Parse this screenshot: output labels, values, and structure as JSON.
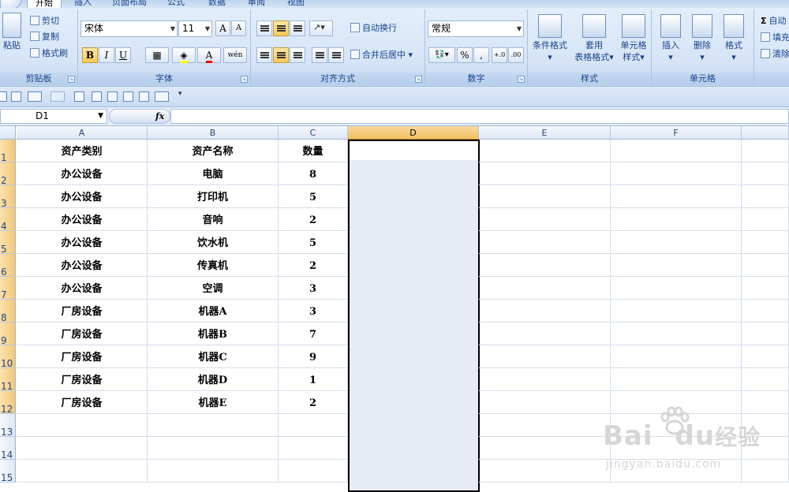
{
  "ribbon": {
    "tabs": [
      "开始",
      "插入",
      "页面布局",
      "公式",
      "数据",
      "审阅",
      "视图"
    ],
    "clipboard": {
      "paste": "粘贴",
      "cut": "剪切",
      "copy": "复制",
      "format_painter": "格式刷",
      "label": "剪贴板"
    },
    "font": {
      "name": "宋体",
      "size": "11",
      "bold": "B",
      "italic": "I",
      "underline": "U",
      "grow": "A",
      "shrink": "A",
      "font_color": "A",
      "label": "字体",
      "wen": "wén"
    },
    "alignment": {
      "wrap_text": "自动换行",
      "merge_center": "合并后居中",
      "label": "对齐方式"
    },
    "number": {
      "format": "常规",
      "percent": "%",
      "comma": ",",
      "inc_dec": "+.0",
      "dec_dec": ".00",
      "label": "数字"
    },
    "styles": {
      "conditional": "条件格式",
      "table_1": "套用",
      "table_2": "表格格式",
      "cell_style_1": "单元格",
      "cell_style_2": "样式",
      "label": "样式"
    },
    "cells": {
      "insert": "插入",
      "delete": "删除",
      "format": "格式",
      "label": "单元格"
    },
    "editing": {
      "autosum": "自动",
      "fill": "填充",
      "clear": "清除",
      "sigma": "Σ"
    }
  },
  "formula_bar": {
    "name_box": "D1",
    "fx": "fx",
    "formula": ""
  },
  "columns": [
    "A",
    "B",
    "C",
    "D",
    "E",
    "F"
  ],
  "rows": [
    {
      "num": "1",
      "a": "资产类别",
      "b": "资产名称",
      "c": "数量"
    },
    {
      "num": "2",
      "a": "办公设备",
      "b": "电脑",
      "c": "8"
    },
    {
      "num": "3",
      "a": "办公设备",
      "b": "打印机",
      "c": "5"
    },
    {
      "num": "4",
      "a": "办公设备",
      "b": "音响",
      "c": "2"
    },
    {
      "num": "5",
      "a": "办公设备",
      "b": "饮水机",
      "c": "5"
    },
    {
      "num": "6",
      "a": "办公设备",
      "b": "传真机",
      "c": "2"
    },
    {
      "num": "7",
      "a": "办公设备",
      "b": "空调",
      "c": "3"
    },
    {
      "num": "8",
      "a": "厂房设备",
      "b": "机器A",
      "c": "3"
    },
    {
      "num": "9",
      "a": "厂房设备",
      "b": "机器B",
      "c": "7"
    },
    {
      "num": "10",
      "a": "厂房设备",
      "b": "机器C",
      "c": "9"
    },
    {
      "num": "11",
      "a": "厂房设备",
      "b": "机器D",
      "c": "1"
    },
    {
      "num": "12",
      "a": "厂房设备",
      "b": "机器E",
      "c": "2"
    },
    {
      "num": "13",
      "a": "",
      "b": "",
      "c": ""
    },
    {
      "num": "14",
      "a": "",
      "b": "",
      "c": ""
    },
    {
      "num": "15",
      "a": "",
      "b": "",
      "c": ""
    }
  ],
  "selected_column": "D",
  "colors": {
    "selection_fill": "#e6ebf5",
    "header_highlight": "#f3c878",
    "ribbon_text": "#15428b"
  },
  "watermark": {
    "brand": "Bai",
    "brand_2": "du",
    "suffix": "经验",
    "url": "jingyan.baidu.com"
  }
}
